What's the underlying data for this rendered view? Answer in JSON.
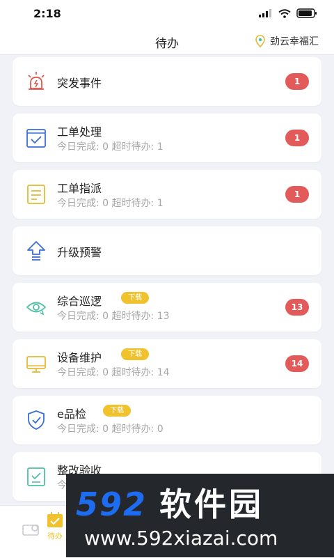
{
  "status_bar": {
    "time": "2:18"
  },
  "header": {
    "title": "待办",
    "location": "劲云幸福汇"
  },
  "items": [
    {
      "name": "突发事件",
      "badge": "1"
    },
    {
      "name": "工单处理",
      "sub": "今日完成: 0  超时待办: 1",
      "badge": "1"
    },
    {
      "name": "工单指派",
      "sub": "今日完成: 0  超时待办: 1",
      "badge": "1"
    },
    {
      "name": "升级预警"
    },
    {
      "name": "综合巡逻",
      "tag": "下载",
      "sub": "今日完成: 0  超时待办: 13",
      "badge": "13"
    },
    {
      "name": "设备维护",
      "tag": "下载",
      "sub": "今日完成: 0  超时待办: 14",
      "badge": "14"
    },
    {
      "name": "e品检",
      "tag": "下载",
      "sub": "今日完成: 0  超时待办: 0"
    },
    {
      "name": "整改验收",
      "sub": "今"
    }
  ],
  "tabbar": {
    "active_label": "待办"
  },
  "watermark": {
    "brand_digits": "592",
    "brand_cn": "软件园",
    "url": "www.592xiazai.com"
  },
  "colors": {
    "badge": "#e35a5a",
    "tag": "#efc22e",
    "alert_icon": "#e0564f",
    "blue_icon": "#3a6fd8",
    "yellow_icon": "#e6b932",
    "teal_icon": "#4fbfa6"
  },
  "icons": [
    "alarm-light-icon",
    "checked-box-icon",
    "document-list-icon",
    "upgrade-arrow-icon",
    "patrol-eye-icon",
    "monitor-icon",
    "shield-check-icon",
    "clipboard-check-icon",
    "location-pin-icon"
  ]
}
